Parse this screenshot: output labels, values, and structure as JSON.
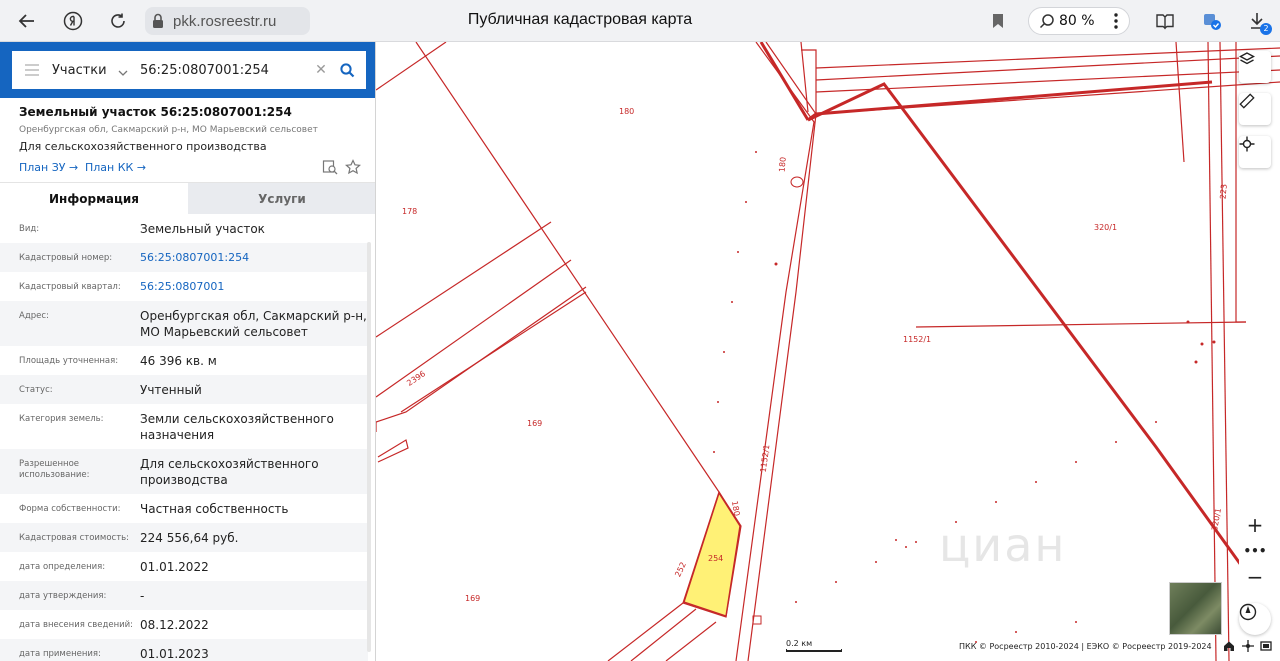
{
  "browser": {
    "url": "pkk.rosreestr.ru",
    "title": "Публичная кадастровая карта",
    "zoom": "80 %",
    "downloads_badge": "2"
  },
  "search": {
    "category": "Участки",
    "query": "56:25:0807001:254"
  },
  "object": {
    "title": "Земельный участок 56:25:0807001:254",
    "address": "Оренбургская обл, Сакмарский р-н, МО Марьевский сельсовет",
    "usage": "Для сельскохозяйственного производства",
    "plan_zu": "План ЗУ →",
    "plan_kk": "План КК →"
  },
  "tabs": {
    "info": "Информация",
    "services": "Услуги"
  },
  "info": [
    {
      "label": "Вид:",
      "value": "Земельный участок",
      "link": false
    },
    {
      "label": "Кадастровый номер:",
      "value": "56:25:0807001:254",
      "link": true
    },
    {
      "label": "Кадастровый квартал:",
      "value": "56:25:0807001",
      "link": true
    },
    {
      "label": "Адрес:",
      "value": "Оренбургская обл, Сакмарский р-н, МО Марьевский сельсовет",
      "link": false
    },
    {
      "label": "Площадь уточненная:",
      "value": "46 396 кв. м",
      "link": false
    },
    {
      "label": "Статус:",
      "value": "Учтенный",
      "link": false
    },
    {
      "label": "Категория земель:",
      "value": "Земли сельскохозяйственного назначения",
      "link": false
    },
    {
      "label": "Разрешенное использование:",
      "value": "Для сельскохозяйственного производства",
      "link": false
    },
    {
      "label": "Форма собственности:",
      "value": "Частная собственность",
      "link": false
    },
    {
      "label": "Кадастровая стоимость:",
      "value": "224 556,64 руб.",
      "link": false
    },
    {
      "label": "дата определения:",
      "value": "01.01.2022",
      "link": false
    },
    {
      "label": "дата утверждения:",
      "value": "-",
      "link": false
    },
    {
      "label": "дата внесения сведений:",
      "value": "08.12.2022",
      "link": false
    },
    {
      "label": "дата применения:",
      "value": "01.01.2023",
      "link": false
    }
  ],
  "map": {
    "labels": {
      "l180a": "180",
      "l180b": "180",
      "l180c": "180",
      "l178": "178",
      "l169a": "169",
      "l169b": "169",
      "l2396": "2396",
      "l252": "252",
      "l254": "254",
      "l1152a": "1152/1",
      "l1152b": "1152/1",
      "l320a": "320/1",
      "l320b": "320/1",
      "l223": "223"
    },
    "watermark": "циан",
    "scale": "0.2 км",
    "copyright": "ПКК © Росреестр 2010-2024 | ЕЭКО © Росреестр 2019-2024",
    "colors": {
      "boundary": "#c62828",
      "selected_fill": "#fff176"
    }
  }
}
